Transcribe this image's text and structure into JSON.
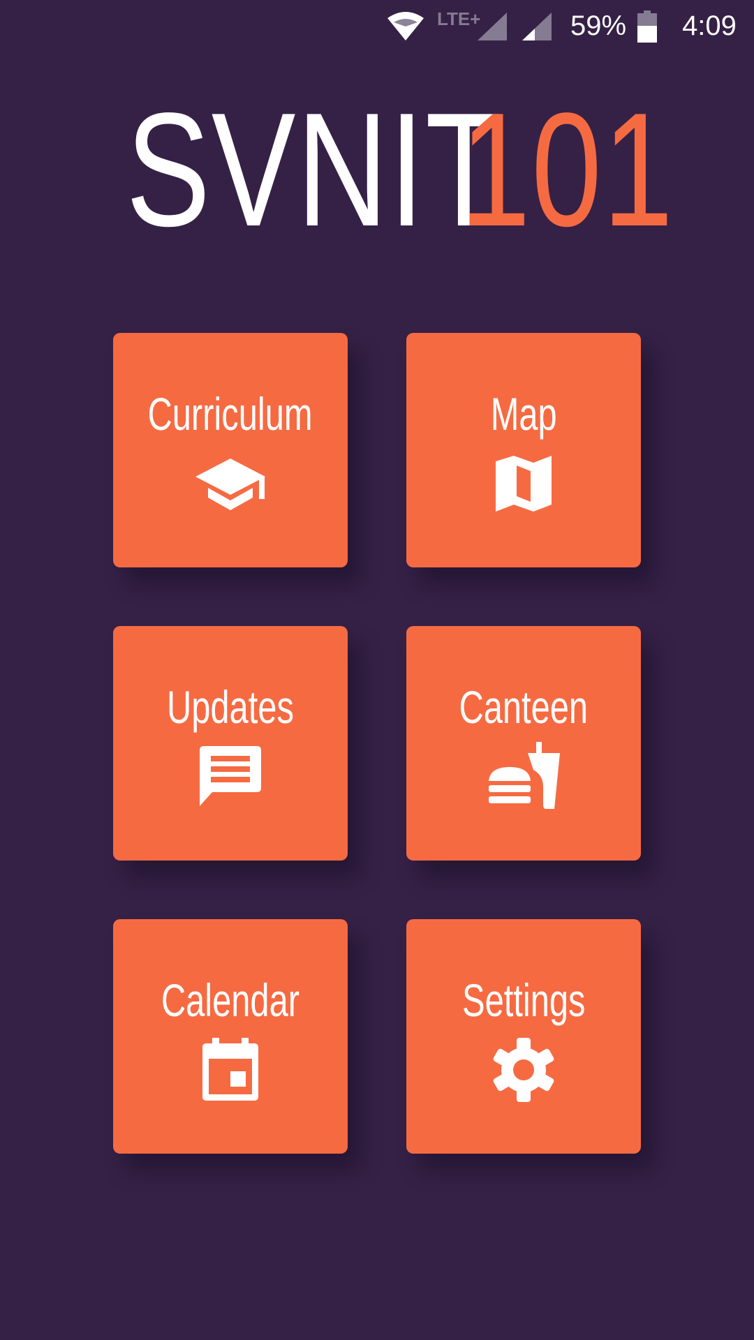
{
  "status_bar": {
    "network_type": "LTE+",
    "battery_percent": "59%",
    "time": "4:09",
    "icons": [
      "wifi-icon",
      "signal-icon",
      "signal-icon",
      "battery-icon"
    ]
  },
  "logo": {
    "main": "SVNIT",
    "accent": "101"
  },
  "tiles": [
    {
      "label": "Curriculum",
      "icon": "graduation-cap-icon"
    },
    {
      "label": "Map",
      "icon": "map-icon"
    },
    {
      "label": "Updates",
      "icon": "message-icon"
    },
    {
      "label": "Canteen",
      "icon": "fastfood-icon"
    },
    {
      "label": "Calendar",
      "icon": "calendar-icon"
    },
    {
      "label": "Settings",
      "icon": "gear-icon"
    }
  ],
  "colors": {
    "background": "#352146",
    "accent": "#f66a42",
    "text": "#ffffff"
  }
}
